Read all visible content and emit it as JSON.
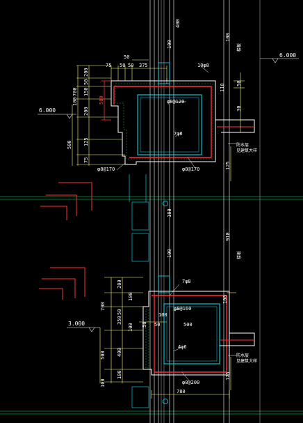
{
  "colors": {
    "background": "#000000",
    "wall_outline": "#00e5ff",
    "rebar": "#ff3030",
    "concrete": "#ffffff",
    "dim_lines": "#ffff66",
    "hatch": "#00c853",
    "grid": "#00e676",
    "text": "#ffffff"
  },
  "levels": {
    "upper": "6.000",
    "upper_right": "6.000",
    "lower": "3.000"
  },
  "upper_beam": {
    "top_dims": [
      "75",
      "50",
      "50",
      "375"
    ],
    "top_single": "50",
    "left_dims": [
      "200",
      "50",
      "150",
      "200",
      "125",
      "75",
      "500"
    ],
    "left_outer": [
      "700",
      "100"
    ],
    "red_dim": "500",
    "rebar_top": "10φ8",
    "stirrup": "φ8@120",
    "bar_mid": "7φ6",
    "stirrup_bottom": "φ8@170",
    "stirrup_left": "φ8@170",
    "right_dims": [
      "110",
      "50",
      "30",
      "100"
    ],
    "right_lower": "125",
    "note_lines": [
      "防水层",
      "见建筑大样"
    ],
    "side_text": "100"
  },
  "lower_beam": {
    "top_rebar": "7φ8",
    "stirrup": "φ8@160",
    "span_dim": "500",
    "bar_mid": "4φ6",
    "stirrup_bottom": "φ8@200",
    "left_dims": [
      "200",
      "100",
      "50",
      "350",
      "100",
      "400",
      "500",
      "100"
    ],
    "left_outer": [
      "700",
      "100"
    ],
    "mid_labels": [
      "100",
      "50",
      "50"
    ],
    "bottom_dim": "780",
    "right_dims": [
      "100",
      "125"
    ],
    "note_lines": [
      "防水层",
      "见建筑大样"
    ]
  },
  "column_dims": {
    "top": "400",
    "upper_mid": "100",
    "middle": "910",
    "lower_mid": "100"
  },
  "right_labels": {
    "upper": "楼板",
    "lower": "楼板"
  }
}
